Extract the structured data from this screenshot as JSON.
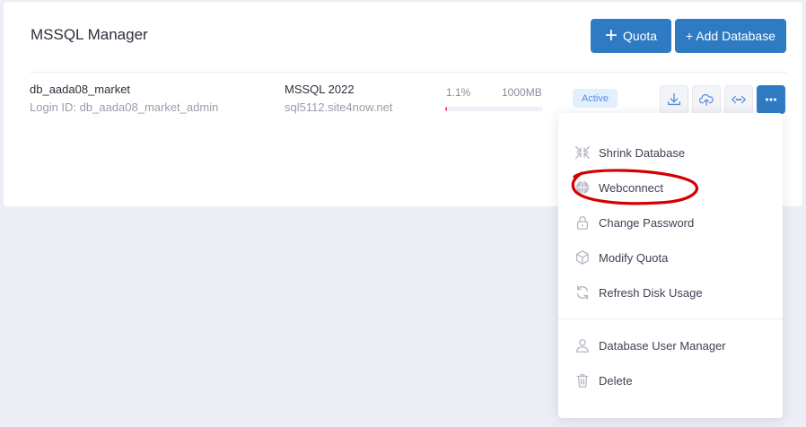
{
  "header": {
    "title": "MSSQL Manager",
    "quota_button": {
      "icon": "plus-icon",
      "label": "Quota"
    },
    "add_database_button": "+ Add Database"
  },
  "database": {
    "name": "db_aada08_market",
    "login": "Login ID: db_aada08_market_admin",
    "engine": "MSSQL 2022",
    "server": "sql5112.site4now.net",
    "usage_percent_text": "1.1%",
    "usage_percent": 1.1,
    "quota_text": "1000MB",
    "status": "Active",
    "actions": [
      {
        "icon": "download-icon"
      },
      {
        "icon": "cloud-upload-icon"
      },
      {
        "icon": "code-connect-icon"
      },
      {
        "icon": "more-dots-icon"
      }
    ]
  },
  "menu": {
    "items": [
      {
        "label": "Shrink Database",
        "icon": "shrink-icon"
      },
      {
        "label": "Webconnect",
        "icon": "web-icon"
      },
      {
        "label": "Change Password",
        "icon": "lock-icon"
      },
      {
        "label": "Modify Quota",
        "icon": "cube-icon"
      },
      {
        "label": "Refresh Disk Usage",
        "icon": "refresh-icon"
      },
      {
        "label": "Database User Manager",
        "icon": "user-icon"
      },
      {
        "label": "Delete",
        "icon": "trash-icon"
      }
    ]
  },
  "colors": {
    "primary": "#2f7bc3",
    "badge_bg": "#e1f0ff",
    "usage_bar": "#f64e60",
    "annotation": "#d40000"
  }
}
